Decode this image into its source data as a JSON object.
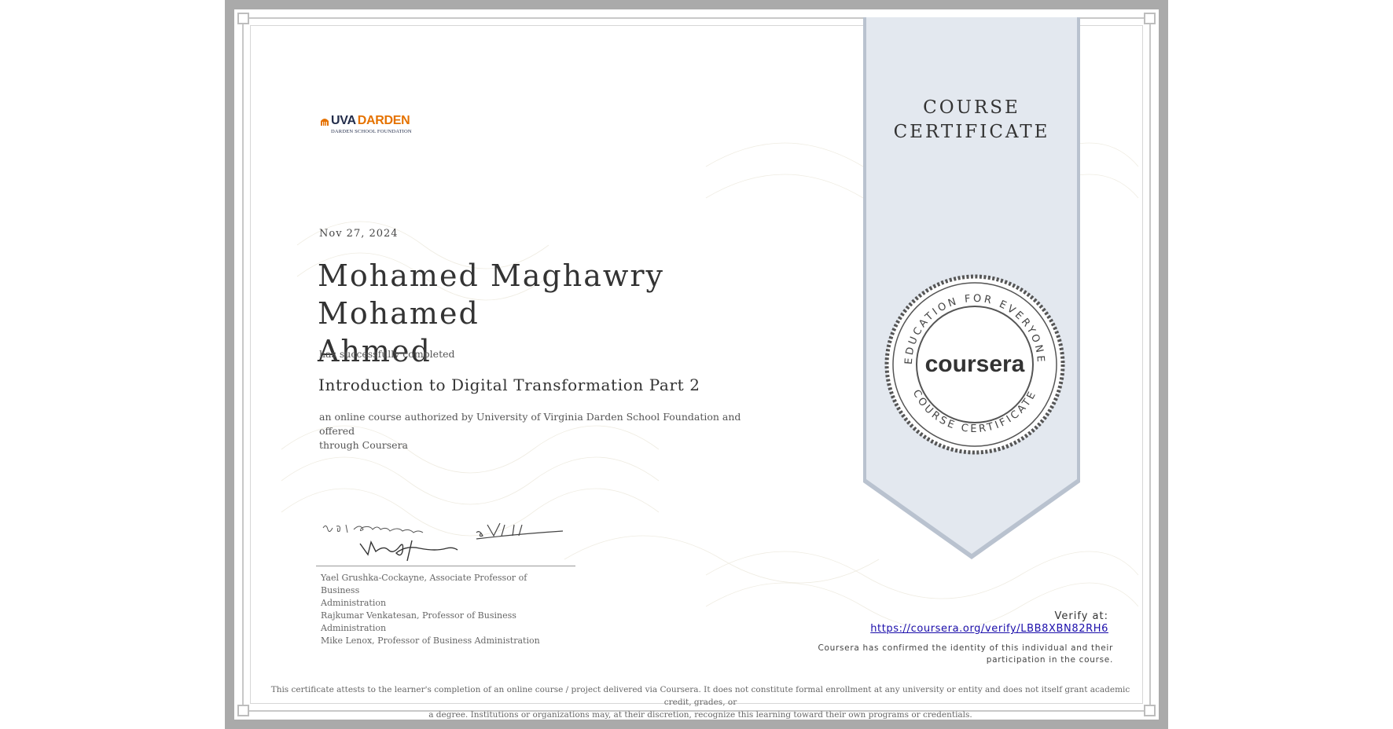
{
  "certificate": {
    "logo": {
      "brand_prefix": "UVA",
      "brand_name": "DARDEN",
      "subtitle": "DARDEN SCHOOL FOUNDATION"
    },
    "date": "Nov 27, 2024",
    "recipient_line1": "Mohamed Maghawry Mohamed",
    "recipient_line2": "Ahmed",
    "completed_text": "has successfully completed",
    "course_title": "Introduction to Digital Transformation Part 2",
    "authorized_line1": "an online course authorized by University of Virginia Darden School Foundation and offered",
    "authorized_line2": "through Coursera",
    "signers": [
      "Yael Grushka-Cockayne, Associate Professor of Business",
      "Administration",
      "Rajkumar Venkatesan, Professor of Business Administration",
      "Mike Lenox, Professor of Business Administration"
    ],
    "ribbon_title_line1": "COURSE",
    "ribbon_title_line2": "CERTIFICATE",
    "seal": {
      "top_text": "EDUCATION FOR EVERYONE",
      "bottom_text": "COURSE CERTIFICATE",
      "center_text": "coursera"
    },
    "verify_label": "Verify at:",
    "verify_url": "https://coursera.org/verify/LBB8XBN82RH6",
    "confirm_line1": "Coursera has confirmed the identity of this individual and their",
    "confirm_line2": "participation in the course.",
    "disclaimer_line1": "This certificate attests to the learner's completion of an online course / project delivered via Coursera. It does not constitute formal enrollment at any university or entity and does not itself grant academic credit, grades, or",
    "disclaimer_line2": "a degree. Institutions or organizations may, at their discretion, recognize this learning toward their own programs or credentials."
  },
  "colors": {
    "frame": "#aaaaaa",
    "ribbon": "#e3e8ef",
    "ribbon_edge": "#b9c2cf",
    "darden_orange": "#e57200",
    "darden_navy": "#232d4b",
    "link": "#1a0dab"
  }
}
